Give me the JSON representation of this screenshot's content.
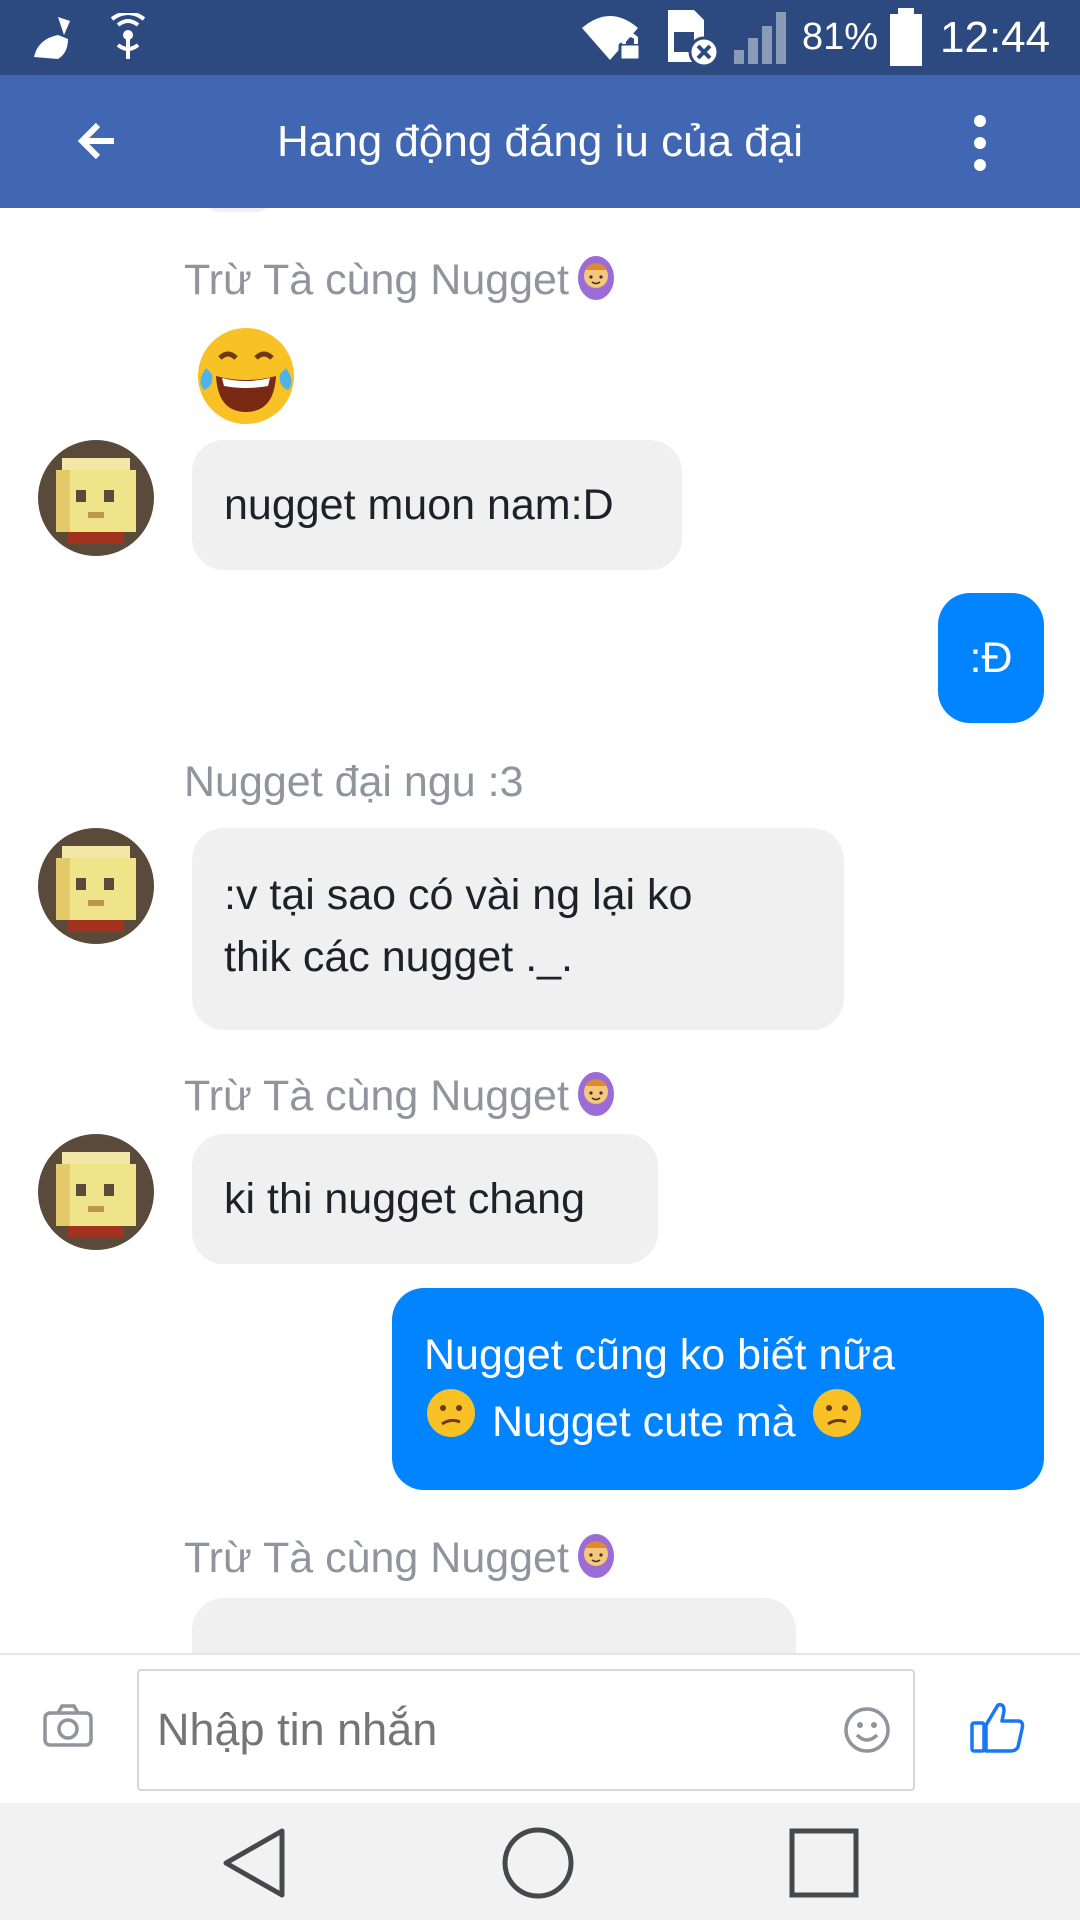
{
  "status_bar": {
    "battery_percent": "81%",
    "time": "12:44"
  },
  "header": {
    "title": "Hang động đáng iu của đại"
  },
  "messages": [
    {
      "type": "sender",
      "name": "Trừ Tà cùng Nugget"
    },
    {
      "type": "emoji",
      "icon": "tears-of-joy-emoji"
    },
    {
      "type": "incoming",
      "text": "nugget muon nam:D"
    },
    {
      "type": "outgoing",
      "text": ":Đ"
    },
    {
      "type": "sender",
      "name": "Nugget đại ngu :3"
    },
    {
      "type": "incoming",
      "line1": ":v tại sao có vài ng lại ko",
      "line2": "thik các nugget ._."
    },
    {
      "type": "sender",
      "name": "Trừ Tà cùng Nugget"
    },
    {
      "type": "incoming",
      "text": "ki thi nugget chang"
    },
    {
      "type": "outgoing",
      "line1": "Nugget cũng ko biết nữa",
      "line2_a": "Nugget cute mà"
    },
    {
      "type": "sender",
      "name": "Trừ Tà cùng Nugget"
    }
  ],
  "composer": {
    "placeholder": "Nhập tin nhắn"
  },
  "colors": {
    "status_bar": "#2c4a80",
    "app_bar": "#4267b2",
    "outgoing_bubble": "#0084ff",
    "incoming_bubble": "#f1f0f0"
  }
}
